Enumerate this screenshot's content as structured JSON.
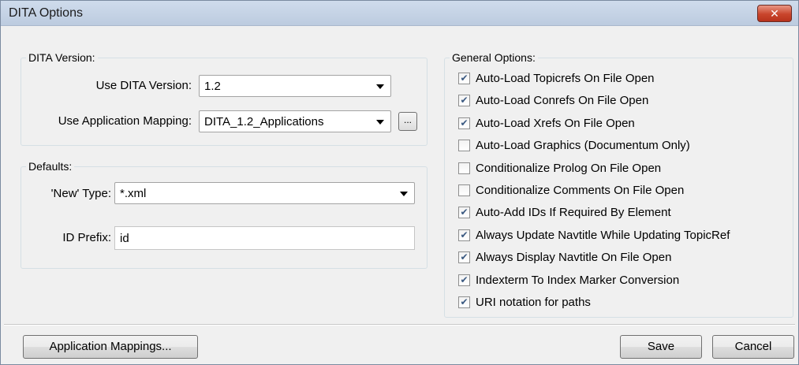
{
  "window": {
    "title": "DITA Options",
    "close_label": "✕"
  },
  "dita_version": {
    "group_label": "DITA Version:",
    "version_label": "Use DITA Version:",
    "version_value": "1.2",
    "mapping_label": "Use Application Mapping:",
    "mapping_value": "DITA_1.2_Applications",
    "browse_label": "..."
  },
  "defaults": {
    "group_label": "Defaults:",
    "new_type_label": "'New' Type:",
    "new_type_value": "*.xml",
    "id_prefix_label": "ID Prefix:",
    "id_prefix_value": "id"
  },
  "general_options": {
    "group_label": "General Options:",
    "items": [
      {
        "label": "Auto-Load Topicrefs On File Open",
        "checked": true
      },
      {
        "label": "Auto-Load Conrefs On File Open",
        "checked": true
      },
      {
        "label": "Auto-Load Xrefs On File Open",
        "checked": true
      },
      {
        "label": "Auto-Load Graphics (Documentum Only)",
        "checked": false
      },
      {
        "label": "Conditionalize Prolog On File Open",
        "checked": false
      },
      {
        "label": "Conditionalize Comments On File Open",
        "checked": false
      },
      {
        "label": "Auto-Add IDs If Required By Element",
        "checked": true
      },
      {
        "label": "Always Update Navtitle While Updating TopicRef",
        "checked": true
      },
      {
        "label": "Always Display Navtitle On File Open",
        "checked": true
      },
      {
        "label": "Indexterm To Index Marker Conversion",
        "checked": true
      },
      {
        "label": "URI notation for paths",
        "checked": true
      }
    ]
  },
  "buttons": {
    "app_mappings": "Application Mappings...",
    "save": "Save",
    "cancel": "Cancel"
  }
}
